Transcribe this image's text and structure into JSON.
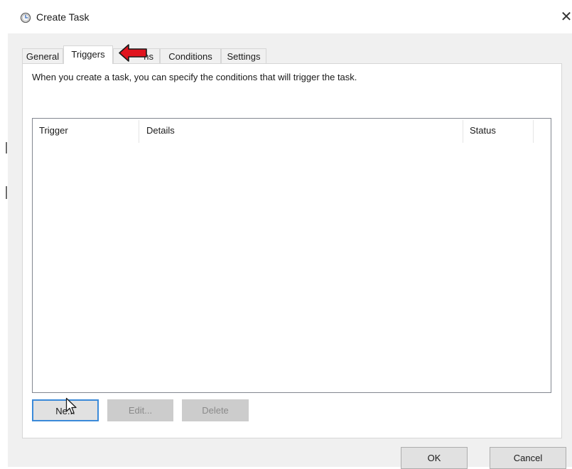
{
  "window": {
    "title": "Create Task",
    "close_glyph": "✕",
    "icon": "clock-icon"
  },
  "tabs": [
    {
      "label": "General",
      "active": false
    },
    {
      "label": "Triggers",
      "active": true
    },
    {
      "label": "hs",
      "active": false
    },
    {
      "label": "Conditions",
      "active": false
    },
    {
      "label": "Settings",
      "active": false
    }
  ],
  "panel": {
    "description": "When you create a task, you can specify the conditions that will trigger the task."
  },
  "triggers_list": {
    "columns": [
      "Trigger",
      "Details",
      "Status"
    ],
    "rows": []
  },
  "panel_buttons": {
    "new_label": "Ne",
    "new_label_tail": "...",
    "edit_label": "Edit...",
    "delete_label": "Delete"
  },
  "dialog_buttons": {
    "ok_label": "OK",
    "cancel_label": "Cancel"
  },
  "colors": {
    "dialog_background": "#f0f0f0",
    "focus_border": "#3b8ad9",
    "annotation_arrow": "#e0141e",
    "disabled_button": "#cccccc"
  },
  "overlays": {
    "annotation_icon": "red-arrow-left-icon",
    "cursor_icon": "mouse-pointer-icon"
  }
}
